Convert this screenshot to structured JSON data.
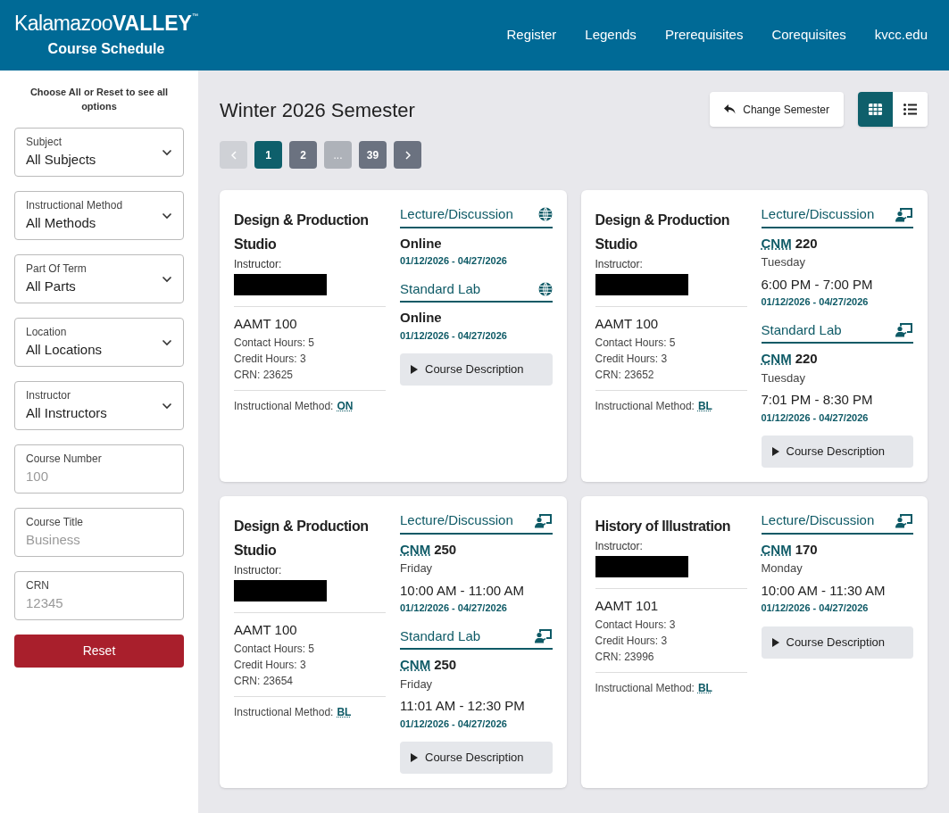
{
  "header": {
    "logo_light": "Kalamazoo",
    "logo_bold": "VALLEY",
    "logo_mark": "™",
    "subtitle": "Course Schedule",
    "nav": [
      "Register",
      "Legends",
      "Prerequisites",
      "Corequisites",
      "kvcc.edu"
    ]
  },
  "sidebar": {
    "note": "Choose All or Reset to see all options",
    "filters": [
      {
        "kind": "select",
        "label": "Subject",
        "value": "All Subjects"
      },
      {
        "kind": "select",
        "label": "Instructional Method",
        "value": "All Methods"
      },
      {
        "kind": "select",
        "label": "Part Of Term",
        "value": "All Parts"
      },
      {
        "kind": "select",
        "label": "Location",
        "value": "All Locations"
      },
      {
        "kind": "select",
        "label": "Instructor",
        "value": "All Instructors"
      },
      {
        "kind": "input",
        "label": "Course Number",
        "placeholder": "100"
      },
      {
        "kind": "input",
        "label": "Course Title",
        "placeholder": "Business"
      },
      {
        "kind": "input",
        "label": "CRN",
        "placeholder": "12345"
      }
    ],
    "reset": "Reset"
  },
  "main": {
    "title": "Winter 2026 Semester",
    "change_semester": "Change Semester",
    "views": [
      {
        "kind": "grid",
        "selected": true
      },
      {
        "kind": "list",
        "selected": false
      }
    ],
    "pagination": {
      "prev_disabled": true,
      "next_disabled": false,
      "pages": [
        {
          "label": "1",
          "selected": true,
          "disabled": false
        },
        {
          "label": "2",
          "selected": false,
          "disabled": false
        },
        {
          "label": "...",
          "selected": false,
          "disabled": true
        },
        {
          "label": "39",
          "selected": false,
          "disabled": false
        }
      ]
    },
    "cards": [
      {
        "title": "Design & Production Studio",
        "instructor_label": "Instructor:",
        "course": "AAMT 100",
        "contact": "Contact Hours: 5",
        "credit": "Credit Hours: 3",
        "crn": "CRN: 23625",
        "method_label": "Instructional Method:",
        "method_code": "ON",
        "description": "Course Description",
        "meetings": [
          {
            "type": "Lecture/Discussion",
            "kind": "online",
            "location": "Online",
            "dates": "01/12/2026 - 04/27/2026"
          },
          {
            "type": "Standard Lab",
            "kind": "online",
            "location": "Online",
            "dates": "01/12/2026 - 04/27/2026"
          }
        ]
      },
      {
        "title": "Design & Production Studio",
        "instructor_label": "Instructor:",
        "course": "AAMT 100",
        "contact": "Contact Hours: 5",
        "credit": "Credit Hours: 3",
        "crn": "CRN: 23652",
        "method_label": "Instructional Method:",
        "method_code": "BL",
        "description": "Course Description",
        "meetings": [
          {
            "type": "Lecture/Discussion",
            "kind": "campus",
            "building": "CNM",
            "room": "220",
            "day": "Tuesday",
            "time": "6:00 PM - 7:00 PM",
            "dates": "01/12/2026 - 04/27/2026"
          },
          {
            "type": "Standard Lab",
            "kind": "campus",
            "building": "CNM",
            "room": "220",
            "day": "Tuesday",
            "time": "7:01 PM - 8:30 PM",
            "dates": "01/12/2026 - 04/27/2026"
          }
        ]
      },
      {
        "title": "Design & Production Studio",
        "instructor_label": "Instructor:",
        "course": "AAMT 100",
        "contact": "Contact Hours: 5",
        "credit": "Credit Hours: 3",
        "crn": "CRN: 23654",
        "method_label": "Instructional Method:",
        "method_code": "BL",
        "description": "Course Description",
        "meetings": [
          {
            "type": "Lecture/Discussion",
            "kind": "campus",
            "building": "CNM",
            "room": "250",
            "day": "Friday",
            "time": "10:00 AM - 11:00 AM",
            "dates": "01/12/2026 - 04/27/2026"
          },
          {
            "type": "Standard Lab",
            "kind": "campus",
            "building": "CNM",
            "room": "250",
            "day": "Friday",
            "time": "11:01 AM - 12:30 PM",
            "dates": "01/12/2026 - 04/27/2026"
          }
        ]
      },
      {
        "title": "History of Illustration",
        "instructor_label": "Instructor:",
        "course": "AAMT 101",
        "contact": "Contact Hours: 3",
        "credit": "Credit Hours: 3",
        "crn": "CRN: 23996",
        "method_label": "Instructional Method:",
        "method_code": "BL",
        "description": "Course Description",
        "meetings": [
          {
            "type": "Lecture/Discussion",
            "kind": "campus",
            "building": "CNM",
            "room": "170",
            "day": "Monday",
            "time": "10:00 AM - 11:30 AM",
            "dates": "01/12/2026 - 04/27/2026"
          }
        ]
      }
    ]
  }
}
